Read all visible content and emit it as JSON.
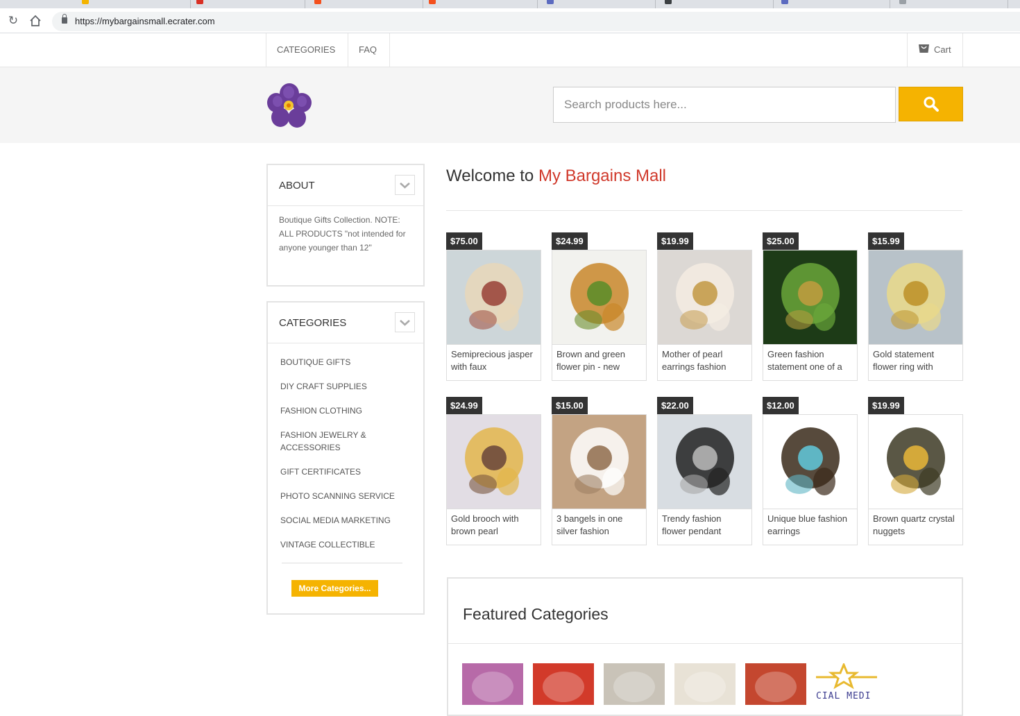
{
  "browser": {
    "url": "https://mybargainsmall.ecrater.com",
    "tab_colors": [
      "#f4b400",
      "#d93025",
      "#f4511e",
      "#f4511e",
      "#5c6bc0",
      "#3c4043",
      "#5c6bc0",
      "#9aa0a6"
    ]
  },
  "topnav": {
    "categories_label": "CATEGORIES",
    "faq_label": "FAQ",
    "cart_label": "Cart"
  },
  "header": {
    "search_placeholder": "Search products here..."
  },
  "sidebar": {
    "about": {
      "title": "ABOUT",
      "text": "Boutique Gifts Collection. NOTE: ALL PRODUCTS \"not intended for anyone younger than 12\""
    },
    "categories": {
      "title": "CATEGORIES",
      "items": [
        "BOUTIQUE GIFTS",
        "DIY CRAFT SUPPLIES",
        "FASHION CLOTHING",
        "FASHION JEWELRY & ACCESSORIES",
        "GIFT CERTIFICATES",
        "PHOTO SCANNING SERVICE",
        "SOCIAL MEDIA MARKETING",
        "VINTAGE COLLECTIBLE"
      ],
      "more_label": "More Categories..."
    }
  },
  "main": {
    "welcome_prefix": "Welcome to",
    "shop_name": "My Bargains Mall",
    "products": [
      {
        "price": "$75.00",
        "title": "Semiprecious jasper with faux",
        "colors": [
          "#cdd6d9",
          "#e8d7b8",
          "#a3564a"
        ]
      },
      {
        "price": "$24.99",
        "title": "Brown and green flower pin - new",
        "colors": [
          "#f2f2ee",
          "#c9872a",
          "#6a8e2d"
        ]
      },
      {
        "price": "$19.99",
        "title": "Mother of pearl earrings fashion",
        "colors": [
          "#dcd8d4",
          "#f4ece2",
          "#c9a45a"
        ]
      },
      {
        "price": "$25.00",
        "title": "Green fashion statement one of a",
        "colors": [
          "#1d3b17",
          "#6aa63a",
          "#b39b3d"
        ]
      },
      {
        "price": "$15.99",
        "title": "Gold statement flower ring with",
        "colors": [
          "#b8c2c9",
          "#e9d98a",
          "#c29a36"
        ]
      },
      {
        "price": "$24.99",
        "title": "Gold brooch with brown pearl",
        "colors": [
          "#e2dde4",
          "#e3b64c",
          "#7a5640"
        ]
      },
      {
        "price": "$15.00",
        "title": "3 bangels in one silver fashion",
        "colors": [
          "#c3a383",
          "#ffffff",
          "#9f8064"
        ]
      },
      {
        "price": "$22.00",
        "title": "Trendy fashion flower pendant",
        "colors": [
          "#d8dde2",
          "#222222",
          "#a8a8a8"
        ]
      },
      {
        "price": "$12.00",
        "title": "Unique blue fashion earrings",
        "colors": [
          "#ffffff",
          "#3a2a1a",
          "#5fb6c4"
        ]
      },
      {
        "price": "$19.99",
        "title": "Brown quartz crystal nuggets",
        "colors": [
          "#ffffff",
          "#3d3a24",
          "#d4a93a"
        ]
      }
    ],
    "featured": {
      "title": "Featured Categories",
      "thumb_colors": [
        "#b76aa8",
        "#d23a2a",
        "#c9c3b8",
        "#e8e2d6",
        "#c4472f",
        "#ffffff"
      ],
      "partial_text": "CIAL MEDI"
    }
  },
  "colors": {
    "accent": "#f5b301",
    "shop_name": "#d0392b",
    "price_bg": "#333333"
  }
}
